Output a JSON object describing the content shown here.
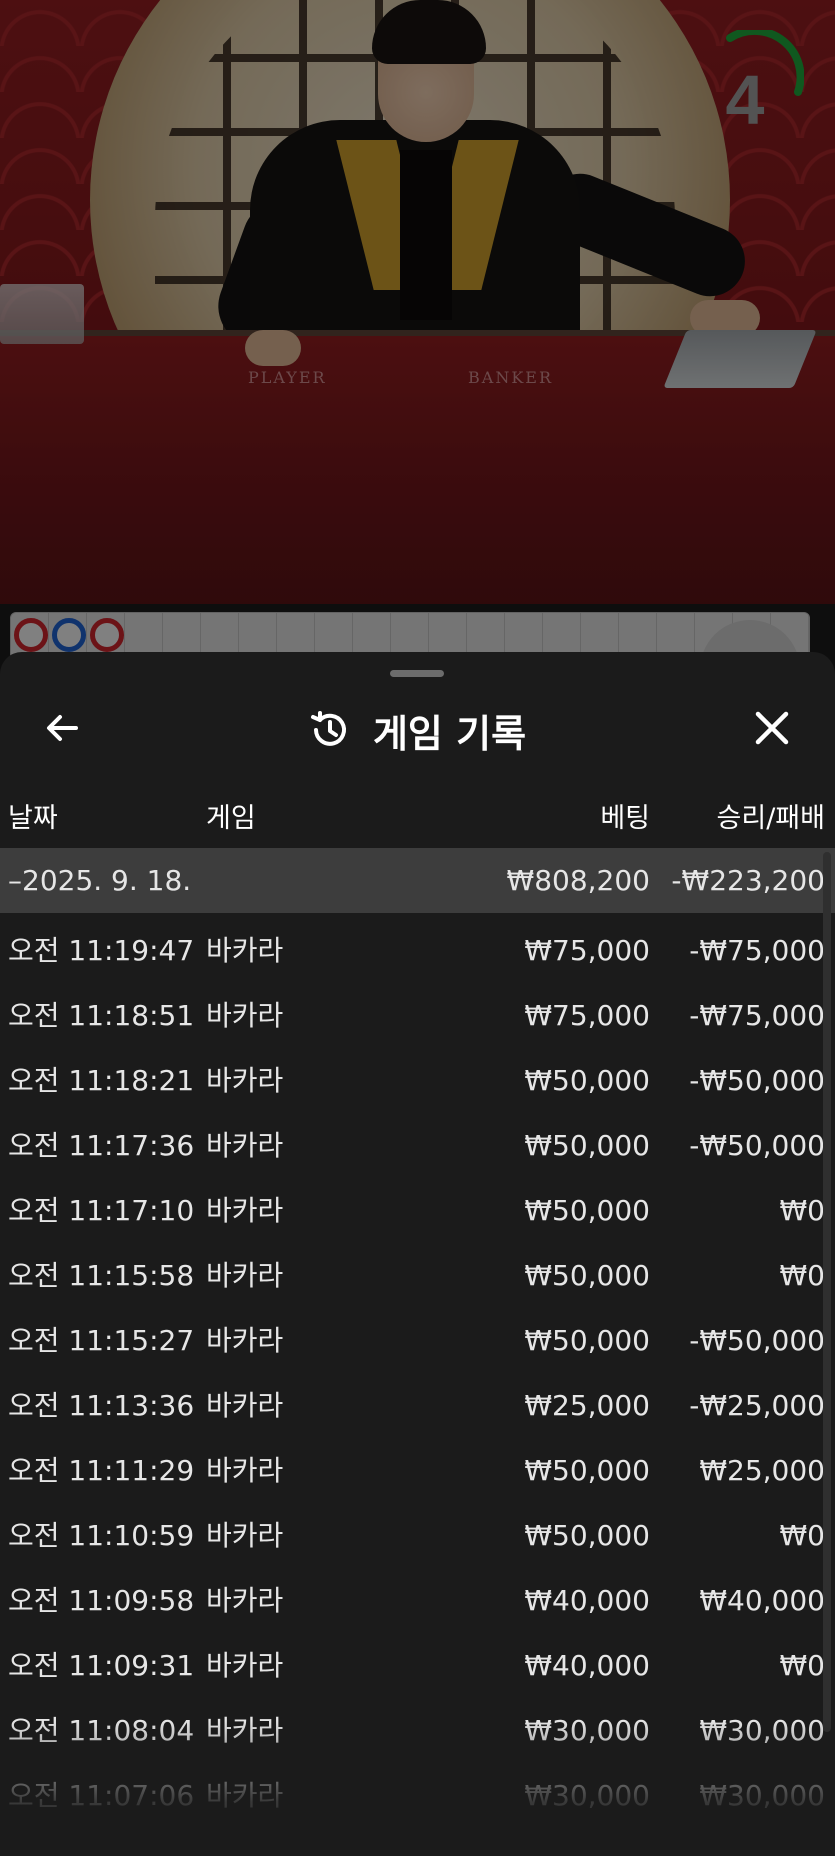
{
  "timer": {
    "value": "4"
  },
  "video": {
    "label_player": "PLAYER",
    "label_banker": "BANKER"
  },
  "header": {
    "title": "게임 기록",
    "back_icon": "arrow-left-icon",
    "history_icon": "history-clock-icon",
    "close_icon": "close-x-icon"
  },
  "columns": {
    "date": "날짜",
    "game": "게임",
    "bet": "베팅",
    "result": "승리/패배"
  },
  "summary": {
    "date": "–2025. 9. 18.",
    "bet": "₩808,200",
    "result": "-₩223,200"
  },
  "rows": [
    {
      "time": "오전 11:19:47",
      "game": "바카라",
      "bet": "₩75,000",
      "result": "-₩75,000"
    },
    {
      "time": "오전 11:18:51",
      "game": "바카라",
      "bet": "₩75,000",
      "result": "-₩75,000"
    },
    {
      "time": "오전 11:18:21",
      "game": "바카라",
      "bet": "₩50,000",
      "result": "-₩50,000"
    },
    {
      "time": "오전 11:17:36",
      "game": "바카라",
      "bet": "₩50,000",
      "result": "-₩50,000"
    },
    {
      "time": "오전 11:17:10",
      "game": "바카라",
      "bet": "₩50,000",
      "result": "₩0"
    },
    {
      "time": "오전 11:15:58",
      "game": "바카라",
      "bet": "₩50,000",
      "result": "₩0"
    },
    {
      "time": "오전 11:15:27",
      "game": "바카라",
      "bet": "₩50,000",
      "result": "-₩50,000"
    },
    {
      "time": "오전 11:13:36",
      "game": "바카라",
      "bet": "₩25,000",
      "result": "-₩25,000"
    },
    {
      "time": "오전 11:11:29",
      "game": "바카라",
      "bet": "₩50,000",
      "result": "₩25,000"
    },
    {
      "time": "오전 11:10:59",
      "game": "바카라",
      "bet": "₩50,000",
      "result": "₩0"
    },
    {
      "time": "오전 11:09:58",
      "game": "바카라",
      "bet": "₩40,000",
      "result": "₩40,000"
    },
    {
      "time": "오전 11:09:31",
      "game": "바카라",
      "bet": "₩40,000",
      "result": "₩0"
    },
    {
      "time": "오전 11:08:04",
      "game": "바카라",
      "bet": "₩30,000",
      "result": "₩30,000"
    },
    {
      "time": "오전 11:07:06",
      "game": "바카라",
      "bet": "₩30,000",
      "result": "₩30,000"
    }
  ],
  "colors": {
    "sheet_bg": "#1b1b1b",
    "summary_bg": "#3d3d3d",
    "timer_ring": "#1ea33a",
    "player_blue": "#1f5fc9",
    "banker_red": "#c8232b"
  }
}
